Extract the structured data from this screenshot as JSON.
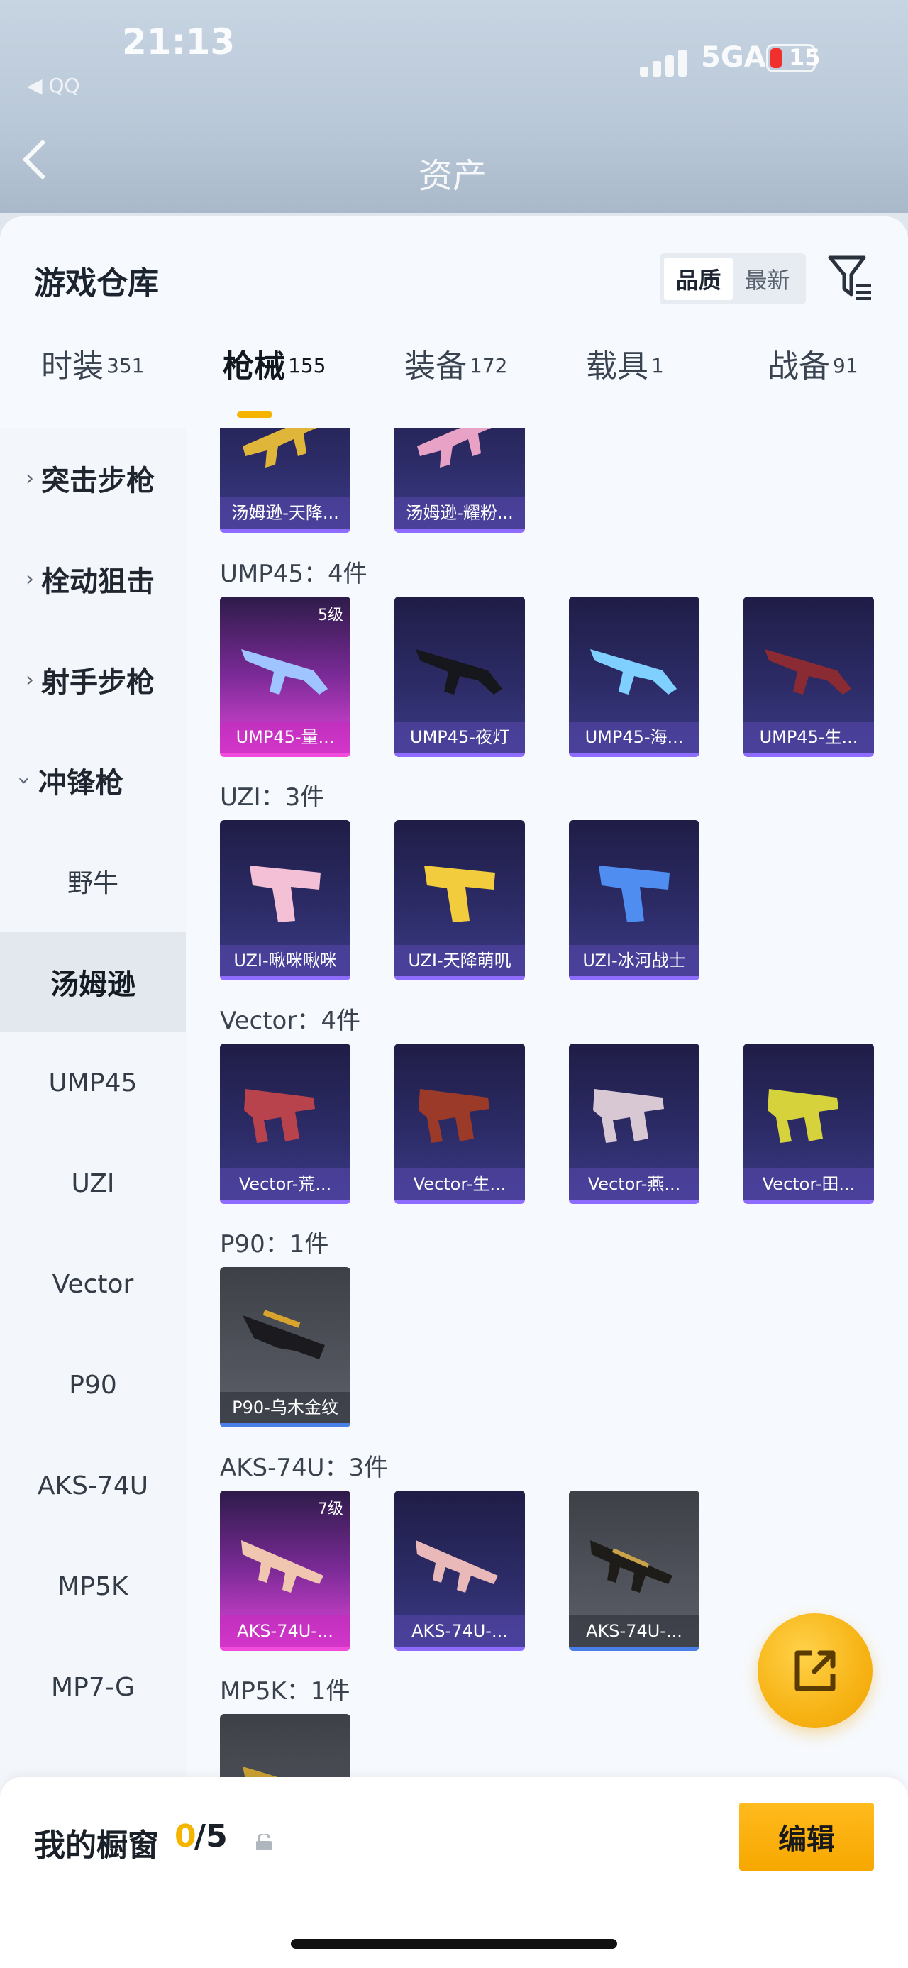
{
  "status": {
    "time": "21:13",
    "back_app": "◀ QQ",
    "network": "5GA",
    "battery": "15"
  },
  "header": {
    "title": "资产"
  },
  "sheet": {
    "title": "游戏仓库",
    "sort_options": [
      "品质",
      "最新"
    ],
    "tabs": [
      {
        "label": "时装",
        "count": "351"
      },
      {
        "label": "枪械",
        "count": "155"
      },
      {
        "label": "装备",
        "count": "172"
      },
      {
        "label": "载具",
        "count": "1"
      },
      {
        "label": "战备",
        "count": "91"
      }
    ]
  },
  "sidebar": {
    "categories": [
      "突击步枪",
      "栓动狙击",
      "射手步枪",
      "冲锋枪"
    ],
    "subitems": [
      "野牛",
      "汤姆逊",
      "UMP45",
      "UZI",
      "Vector",
      "P90",
      "AKS-74U",
      "MP5K",
      "MP7-G"
    ]
  },
  "content": {
    "partial_row": [
      "汤姆逊-天降...",
      "汤姆逊-耀粉..."
    ],
    "groups": [
      {
        "label": "UMP45：4件",
        "items": [
          {
            "name": "UMP45-量...",
            "level": "5级",
            "rarity": "pink"
          },
          {
            "name": "UMP45-夜灯",
            "rarity": "purple"
          },
          {
            "name": "UMP45-海...",
            "rarity": "purple"
          },
          {
            "name": "UMP45-生...",
            "rarity": "purple"
          }
        ]
      },
      {
        "label": "UZI：3件",
        "items": [
          {
            "name": "UZI-啾咪啾咪",
            "rarity": "purple"
          },
          {
            "name": "UZI-天降萌叽",
            "rarity": "purple"
          },
          {
            "name": "UZI-冰河战士",
            "rarity": "purple"
          }
        ]
      },
      {
        "label": "Vector：4件",
        "items": [
          {
            "name": "Vector-荒...",
            "rarity": "purple"
          },
          {
            "name": "Vector-生...",
            "rarity": "purple"
          },
          {
            "name": "Vector-燕...",
            "rarity": "purple"
          },
          {
            "name": "Vector-田...",
            "rarity": "purple"
          }
        ]
      },
      {
        "label": "P90：1件",
        "items": [
          {
            "name": "P90-乌木金纹",
            "rarity": "gray"
          }
        ]
      },
      {
        "label": "AKS-74U：3件",
        "items": [
          {
            "name": "AKS-74U-...",
            "level": "7级",
            "rarity": "pink"
          },
          {
            "name": "AKS-74U-...",
            "rarity": "purple"
          },
          {
            "name": "AKS-74U-...",
            "rarity": "gray"
          }
        ]
      },
      {
        "label": "MP5K：1件",
        "items": []
      }
    ]
  },
  "bottom": {
    "label": "我的橱窗",
    "count": "0",
    "total": "/5",
    "edit": "编辑"
  },
  "colors": {
    "accent": "#f5b400",
    "pink": "#e046d8",
    "purple": "#3b3a86",
    "gray": "#50535b"
  }
}
